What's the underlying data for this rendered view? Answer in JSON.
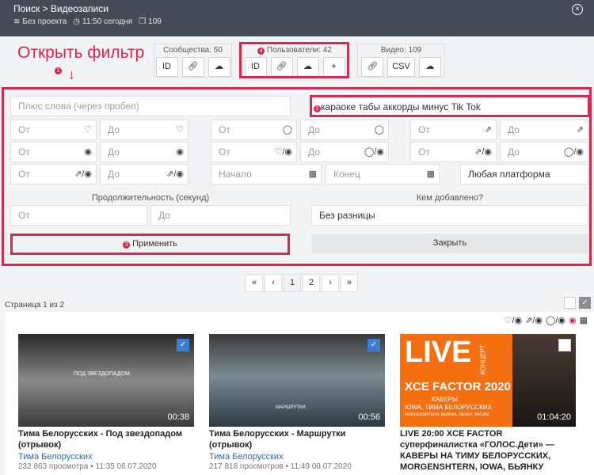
{
  "header": {
    "title": "Поиск > Видеозаписи",
    "project": "Без проекта",
    "time": "11:50 сегодня",
    "count": "109"
  },
  "annotations": {
    "open_filter": "Открыть фильтр",
    "badge1": "1",
    "badge2": "2",
    "badge3": "3",
    "badge4": "4"
  },
  "groups": {
    "communities": {
      "title": "Сообщества: 50",
      "id_label": "ID"
    },
    "users": {
      "title": "Пользователи: 42",
      "id_label": "ID"
    },
    "video": {
      "title": "Видео: 109",
      "csv_label": "CSV"
    }
  },
  "filter": {
    "plus_words_placeholder": "Плюс слова (через пробел)",
    "query_value": "караоке табы аккорды минус Tik Tok",
    "from": "От",
    "to": "До",
    "start": "Начало",
    "end": "Конец",
    "platform": "Любая платформа",
    "duration_label": "Продолжительность (секунд)",
    "added_by_label": "Кем добавлено?",
    "added_by_value": "Без разницы",
    "apply_label": "Применить",
    "close_label": "Закрыть"
  },
  "pager": {
    "first": "«",
    "prev": "‹",
    "p1": "1",
    "p2": "2",
    "next": "›",
    "last": "»",
    "page_text": "Страница 1 из 2"
  },
  "videos": [
    {
      "overlay": "ПОД ЗВЕЗДОПАДОМ",
      "duration": "00:38",
      "title": "Тима Белорусских - Под звездопадом (отрывок)",
      "author": "Тима Белорусских",
      "stats": "232 863 просмотра • 11:35 06.07.2020"
    },
    {
      "overlay": "МАРШРУТКИ",
      "duration": "00:56",
      "title": "Тима Белорусских - Маршрутки (отрывок)",
      "author": "Тима Белорусских",
      "stats": "217 818 просмотров • 11:49 08.07.2020"
    },
    {
      "overlay_live": "LIVE",
      "overlay_concert": "КОНЦЕРТ",
      "overlay_factor": "XCE FACTOR 2020",
      "overlay_covers": "КАВЕРЫ",
      "overlay_names": "IOWA, ТИМА БЕЛОРУССКИХ",
      "overlay_small": "MORGENSHTERN, БЬЯНКА, HENSY, MACAN",
      "duration": "01:04:20",
      "title": "LIVE 20:00 XCE FACTOR суперфиналистка «ГОЛОС.Дети» — КАВЕРЫ НА ТИМУ БЕЛОРУССКИХ, MORGENSHTERN, IOWA, БЬЯНКУ"
    }
  ],
  "colors": {
    "accent": "#d32a52",
    "topbar": "#434b57",
    "link": "#2f6aa8"
  }
}
